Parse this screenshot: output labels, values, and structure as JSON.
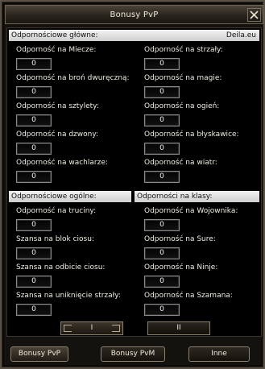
{
  "window": {
    "title": "Bonusy PvP"
  },
  "sections": {
    "main_resist": {
      "title": "Odpornościowe główne:",
      "brand": "Deila.eu"
    },
    "general_resist": {
      "title": "Odpornościowe ogólne:"
    },
    "class_resist": {
      "title": "Odporności na klasy:"
    }
  },
  "main_resist_left": [
    {
      "label": "Odporność na Miecze:",
      "value": "0"
    },
    {
      "label": "Odporność na broń dwuręczną:",
      "value": "0"
    },
    {
      "label": "Odporność na sztylety:",
      "value": "0"
    },
    {
      "label": "Odporność na dzwony:",
      "value": "0"
    },
    {
      "label": "Odporność na wachlarze:",
      "value": "0"
    }
  ],
  "main_resist_right": [
    {
      "label": "Odporność na strzały:",
      "value": "0"
    },
    {
      "label": "Odporność na magie:",
      "value": "0"
    },
    {
      "label": "Odporność na ogień:",
      "value": "0"
    },
    {
      "label": "Odporność na błyskawice:",
      "value": "0"
    },
    {
      "label": "Odporność na wiatr:",
      "value": "0"
    }
  ],
  "general_left": [
    {
      "label": "Odporność na truciny:",
      "value": "0"
    },
    {
      "label": "Szansa na blok ciosu:",
      "value": "0"
    },
    {
      "label": "Szansa na odbicie ciosu:",
      "value": "0"
    },
    {
      "label": "Szansa na uniknięcie strzały:",
      "value": "0"
    }
  ],
  "class_right": [
    {
      "label": "Odporność na Wojownika:",
      "value": "0"
    },
    {
      "label": "Odporność na Sure:",
      "value": "0"
    },
    {
      "label": "Odporność na Ninje:",
      "value": "0"
    },
    {
      "label": "Odporność na Szamana:",
      "value": "0"
    }
  ],
  "pages": {
    "page1": "I",
    "page2": "II"
  },
  "tabs": {
    "pvp": "Bonusy PvP",
    "pvm": "Bonusy PvM",
    "other": "Inne"
  }
}
